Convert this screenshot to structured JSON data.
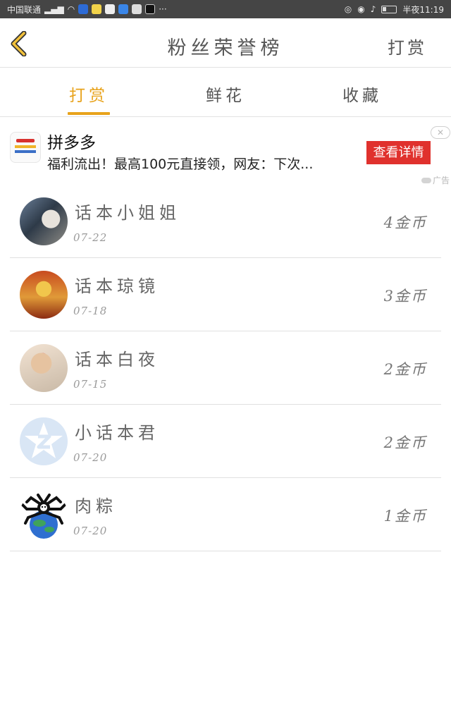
{
  "status_bar": {
    "carrier": "中国联通",
    "dots": "···",
    "time": "半夜11:19"
  },
  "header": {
    "title": "粉丝荣誉榜",
    "right_label": "打赏"
  },
  "tabs": [
    {
      "label": "打赏",
      "active": true
    },
    {
      "label": "鲜花",
      "active": false
    },
    {
      "label": "收藏",
      "active": false
    }
  ],
  "ad": {
    "name": "拼多多",
    "description": "福利流出！最高100元直接领，网友：下次...",
    "cta": "查看详情",
    "close": "✕",
    "tag": "广告"
  },
  "ranking": [
    {
      "name": "话本小姐姐",
      "date": "07-22",
      "coins": "4金币"
    },
    {
      "name": "话本琼镜",
      "date": "07-18",
      "coins": "3金币"
    },
    {
      "name": "话本白夜",
      "date": "07-15",
      "coins": "2金币"
    },
    {
      "name": "小话本君",
      "date": "07-20",
      "coins": "2金币"
    },
    {
      "name": "肉粽",
      "date": "07-20",
      "coins": "1金币"
    }
  ],
  "colors": {
    "accent": "#e8a31c",
    "ad_button": "#e0312d",
    "status_bar": "#454545"
  }
}
